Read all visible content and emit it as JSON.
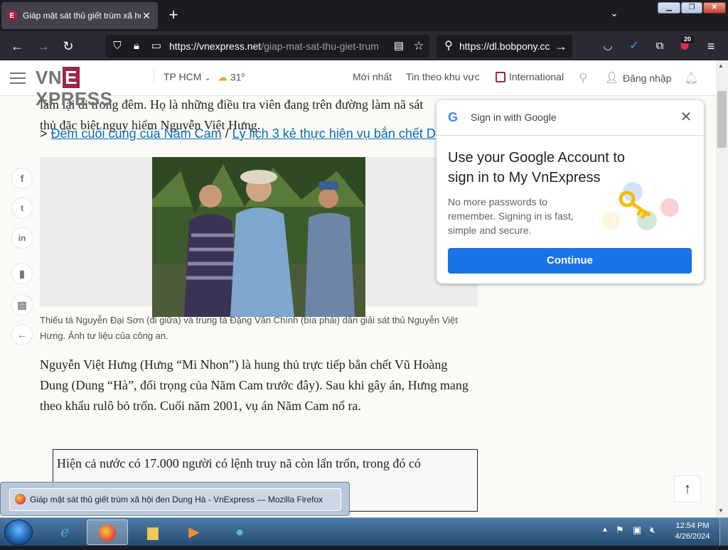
{
  "browser": {
    "tab_title": "Giáp mặt sát thủ giết trùm xã hội",
    "new_tab": "+",
    "tab_list": "⌄",
    "url_host": "https://vnexpress.net",
    "url_path": "/giap-mat-sat-thu-giet-trum",
    "search_text": "https://dl.bobpony.cc",
    "extension_badge": "20"
  },
  "site": {
    "logo": {
      "pre": "VN",
      "e": "E",
      "post": "XPRESS"
    },
    "location": "TP HCM",
    "temperature": "31",
    "temp_unit": "o",
    "nav_latest": "Mới nhất",
    "nav_regional": "Tin theo khu vực",
    "nav_international": "International",
    "login": "Đăng nhập"
  },
  "article": {
    "para_top_1": "làm lại đi trong đêm. Họ là những điều tra viên đang trên đường làm nã sát",
    "para_top_2": "thủ đặc biệt nguy hiểm Nguyễn Việt Hưng.",
    "related_prefix": ">",
    "related_1": "Đêm cuối cùng của Năm Cam",
    "related_sep": "/",
    "related_2": "Lý lịch 3 kẻ thực hiện vụ bắn chết D",
    "caption": "Thiếu tá Nguyễn Đại Sơn (đi giữa) và trung tá Đặng Văn Chính (bìa phải) dẫn giải sát thủ Nguyễn Việt Hưng. Ảnh tư liệu của công an.",
    "para_main": "Nguyễn Việt Hưng (Hưng “Mi Nhon”) là hung thủ trực tiếp bắn chết Vũ Hoàng Dung (Dung “Hà”, đối trọng của Năm Cam trước đây). Sau khi gây án, Hưng mang theo khẩu rulô bỏ trốn. Cuối năm 2001, vụ án Năm Cam nổ ra.",
    "note_text": "Hiện cả nước có 17.000 người có lệnh truy nã còn lẩn trốn, trong đó có"
  },
  "google_popup": {
    "title": "Sign in with Google",
    "heading": "Use your Google Account to sign in to My VnExpress",
    "body": "No more passwords to remember. Signing in is fast, simple and secure.",
    "button": "Continue"
  },
  "taskbar": {
    "preview_title": "Giáp mặt sát thủ giết trùm xã hội đen Dung Hà - VnExpress — Mozilla Firefox",
    "time": "12:54 PM",
    "date": "4/26/2024"
  }
}
